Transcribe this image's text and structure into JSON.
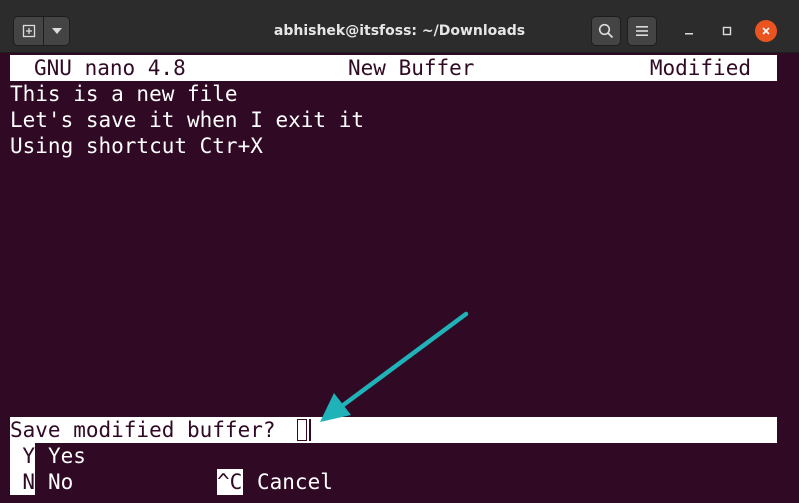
{
  "window": {
    "title": "abhishek@itsfoss: ~/Downloads",
    "buttons": {
      "new_tab_icon": "new-tab-icon",
      "menu_arrow_icon": "chevron-down-icon",
      "search_icon": "search-icon",
      "hamburger_icon": "hamburger-menu-icon",
      "minimize_icon": "minimize-icon",
      "maximize_icon": "maximize-icon",
      "close_icon": "close-icon"
    },
    "colors": {
      "titlebar": "#2c2c2c",
      "terminal_bg": "#300a24",
      "close_button": "#e95420",
      "annotation_arrow": "#1fb2b8"
    }
  },
  "nano": {
    "header": {
      "version": "GNU nano 4.8",
      "buffer_name": "New Buffer",
      "state": "Modified"
    },
    "lines": [
      "This is a new file",
      "Let's save it when I exit it",
      "Using shortcut Ctr+X"
    ],
    "prompt": "Save modified buffer?",
    "options": [
      {
        "key": "Y",
        "label": "Yes"
      },
      {
        "key": "N",
        "label": "No"
      },
      {
        "key": "^C",
        "label": "Cancel"
      }
    ]
  }
}
